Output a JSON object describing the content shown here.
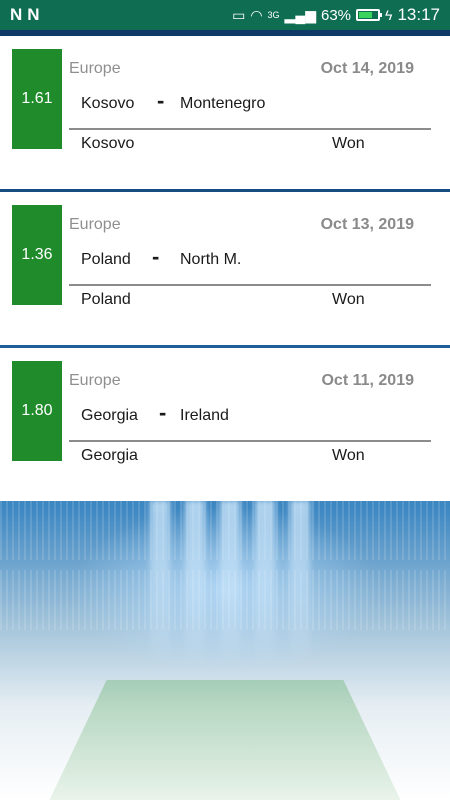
{
  "status_bar": {
    "time": "13:17",
    "battery": "63%",
    "battery_level": 0.63,
    "network": "3G"
  },
  "matches": [
    {
      "odds": "1.61",
      "region": "Europe",
      "date": "Oct 14, 2019",
      "home": "Kosovo",
      "away": "Montenegro",
      "separator": "-",
      "winner": "Kosovo",
      "result": "Won"
    },
    {
      "odds": "1.36",
      "region": "Europe",
      "date": "Oct 13, 2019",
      "home": "Poland",
      "away": "North M.",
      "separator": "-",
      "winner": "Poland",
      "result": "Won"
    },
    {
      "odds": "1.80",
      "region": "Europe",
      "date": "Oct 11, 2019",
      "home": "Georgia",
      "away": "Ireland",
      "separator": "-",
      "winner": "Georgia",
      "result": "Won"
    }
  ],
  "colors": {
    "status_bar": "#0f6e52",
    "odds_badge": "#1f8b2b"
  }
}
